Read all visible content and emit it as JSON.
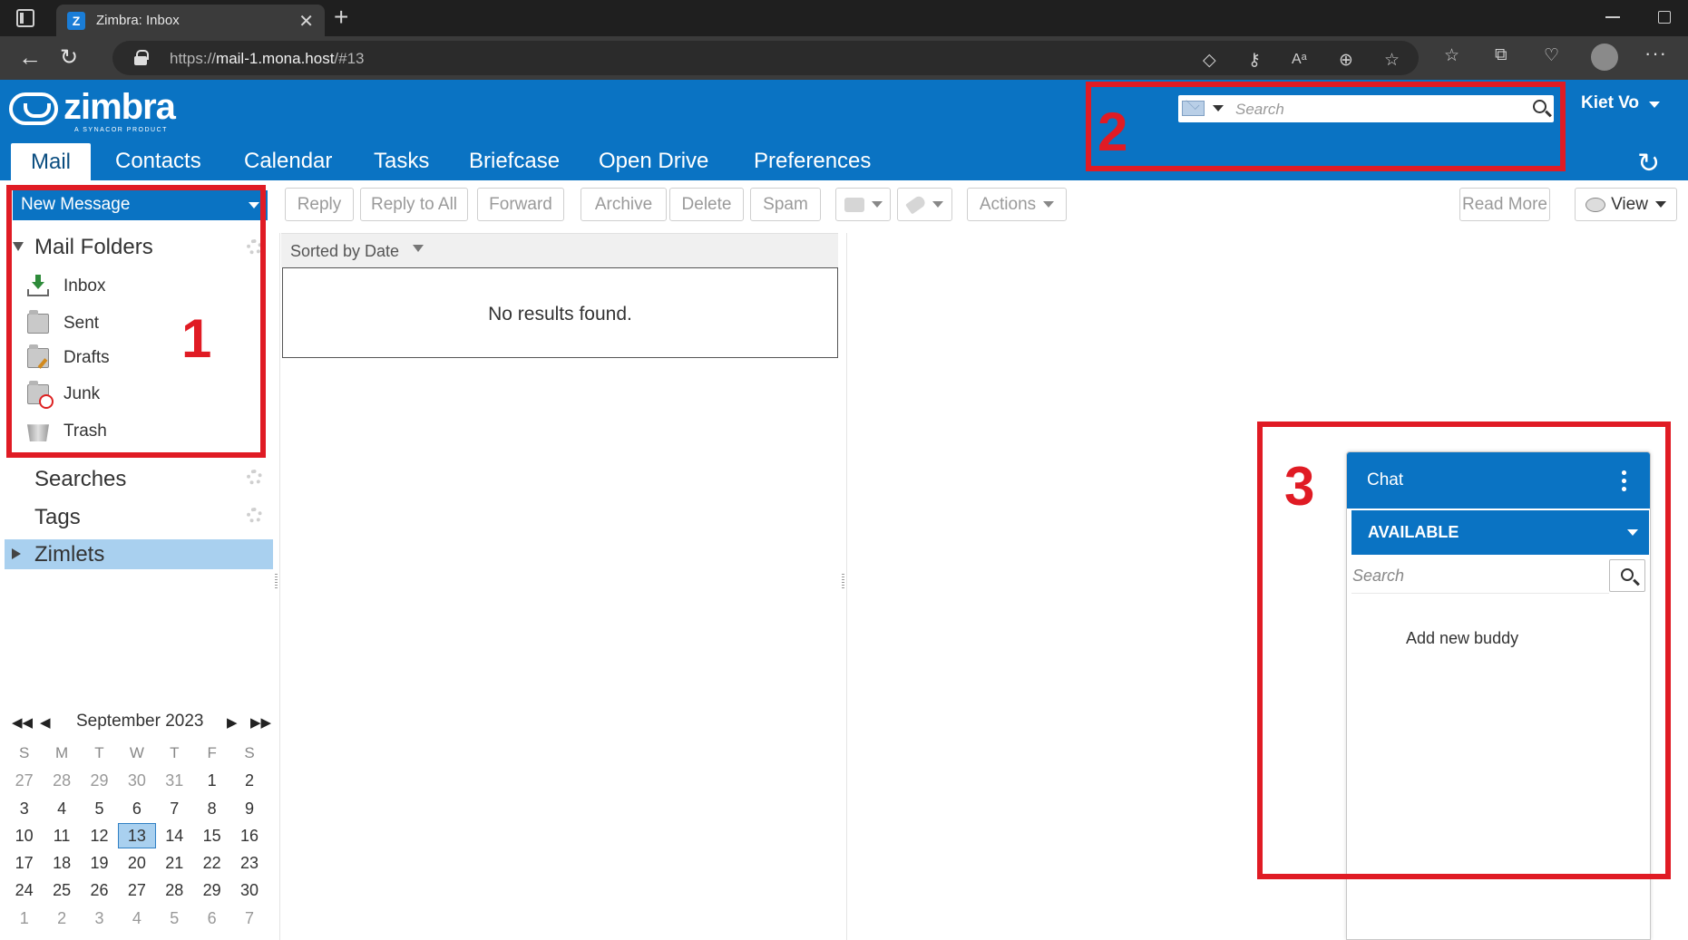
{
  "browser": {
    "tab_title": "Zimbra: Inbox",
    "tab_favicon": "Z",
    "url_scheme": "https://",
    "url_host": "mail-1.mona.host",
    "url_path": "/#13"
  },
  "header": {
    "logo_text": "zimbra",
    "logo_sub": "A SYNACOR PRODUCT",
    "search_placeholder": "Search",
    "user_name": "Kiet Vo"
  },
  "app_tabs": [
    "Mail",
    "Contacts",
    "Calendar",
    "Tasks",
    "Briefcase",
    "Open Drive",
    "Preferences"
  ],
  "toolbar": {
    "new_message": "New Message",
    "reply": "Reply",
    "reply_all": "Reply to All",
    "forward": "Forward",
    "archive": "Archive",
    "delete": "Delete",
    "spam": "Spam",
    "actions": "Actions",
    "read_more": "Read More",
    "view": "View"
  },
  "sidebar": {
    "mail_folders": "Mail Folders",
    "folders": [
      "Inbox",
      "Sent",
      "Drafts",
      "Junk",
      "Trash"
    ],
    "searches": "Searches",
    "tags": "Tags",
    "zimlets": "Zimlets"
  },
  "calendar": {
    "month_label": "September 2023",
    "weekdays": [
      "S",
      "M",
      "T",
      "W",
      "T",
      "F",
      "S"
    ],
    "weeks": [
      [
        "27",
        "28",
        "29",
        "30",
        "31",
        "1",
        "2"
      ],
      [
        "3",
        "4",
        "5",
        "6",
        "7",
        "8",
        "9"
      ],
      [
        "10",
        "11",
        "12",
        "13",
        "14",
        "15",
        "16"
      ],
      [
        "17",
        "18",
        "19",
        "20",
        "21",
        "22",
        "23"
      ],
      [
        "24",
        "25",
        "26",
        "27",
        "28",
        "29",
        "30"
      ],
      [
        "1",
        "2",
        "3",
        "4",
        "5",
        "6",
        "7"
      ]
    ],
    "today": "13"
  },
  "message_list": {
    "sort_label": "Sorted by Date",
    "empty_text": "No results found."
  },
  "annotations": [
    "1",
    "2",
    "3"
  ],
  "chat": {
    "title": "Chat",
    "status": "AVAILABLE",
    "search_placeholder": "Search",
    "add_buddy": "Add new buddy"
  },
  "colors": {
    "brand_blue": "#0a73c3",
    "selection_blue": "#a9d0ef",
    "annotation_red": "#e01b24"
  }
}
